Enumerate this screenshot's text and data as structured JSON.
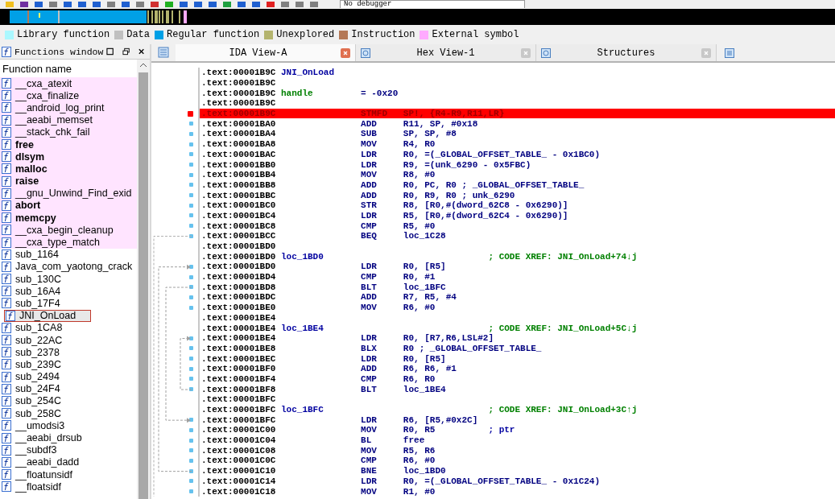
{
  "toolbar": {
    "debugger": "No debugger"
  },
  "legend": [
    {
      "label": "Library function",
      "color": "#aaf8ff"
    },
    {
      "label": "Data",
      "color": "#c0c0c0"
    },
    {
      "label": "Regular function",
      "color": "#00a0e6"
    },
    {
      "label": "Unexplored",
      "color": "#b4b46e"
    },
    {
      "label": "Instruction",
      "color": "#b47856"
    },
    {
      "label": "External symbol",
      "color": "#ffaaff"
    }
  ],
  "functions_window": {
    "title": "Functions window",
    "column": "Function name",
    "items": [
      {
        "name": "__cxa_atexit",
        "bold": false,
        "external": true,
        "selected": false
      },
      {
        "name": "__cxa_finalize",
        "bold": false,
        "external": true,
        "selected": false
      },
      {
        "name": "__android_log_print",
        "bold": false,
        "external": true,
        "selected": false
      },
      {
        "name": "__aeabi_memset",
        "bold": false,
        "external": true,
        "selected": false
      },
      {
        "name": "__stack_chk_fail",
        "bold": false,
        "external": true,
        "selected": false
      },
      {
        "name": "free",
        "bold": true,
        "external": true,
        "selected": false
      },
      {
        "name": "dlsym",
        "bold": true,
        "external": true,
        "selected": false
      },
      {
        "name": "malloc",
        "bold": true,
        "external": true,
        "selected": false
      },
      {
        "name": "raise",
        "bold": true,
        "external": true,
        "selected": false
      },
      {
        "name": "__gnu_Unwind_Find_exid",
        "bold": false,
        "external": true,
        "selected": false
      },
      {
        "name": "abort",
        "bold": true,
        "external": true,
        "selected": false
      },
      {
        "name": "memcpy",
        "bold": true,
        "external": true,
        "selected": false
      },
      {
        "name": "__cxa_begin_cleanup",
        "bold": false,
        "external": true,
        "selected": false
      },
      {
        "name": "__cxa_type_match",
        "bold": false,
        "external": true,
        "selected": false
      },
      {
        "name": "sub_1164",
        "bold": false,
        "external": false,
        "selected": false
      },
      {
        "name": "Java_com_yaotong_crack",
        "bold": false,
        "external": false,
        "selected": false
      },
      {
        "name": "sub_130C",
        "bold": false,
        "external": false,
        "selected": false
      },
      {
        "name": "sub_16A4",
        "bold": false,
        "external": false,
        "selected": false
      },
      {
        "name": "sub_17F4",
        "bold": false,
        "external": false,
        "selected": false
      },
      {
        "name": "JNI_OnLoad",
        "bold": false,
        "external": false,
        "selected": true
      },
      {
        "name": "sub_1CA8",
        "bold": false,
        "external": false,
        "selected": false
      },
      {
        "name": "sub_22AC",
        "bold": false,
        "external": false,
        "selected": false
      },
      {
        "name": "sub_2378",
        "bold": false,
        "external": false,
        "selected": false
      },
      {
        "name": "sub_239C",
        "bold": false,
        "external": false,
        "selected": false
      },
      {
        "name": "sub_2494",
        "bold": false,
        "external": false,
        "selected": false
      },
      {
        "name": "sub_24F4",
        "bold": false,
        "external": false,
        "selected": false
      },
      {
        "name": "sub_254C",
        "bold": false,
        "external": false,
        "selected": false
      },
      {
        "name": "sub_258C",
        "bold": false,
        "external": false,
        "selected": false
      },
      {
        "name": "__umodsi3",
        "bold": false,
        "external": false,
        "selected": false
      },
      {
        "name": "__aeabi_drsub",
        "bold": false,
        "external": false,
        "selected": false
      },
      {
        "name": "__subdf3",
        "bold": false,
        "external": false,
        "selected": false
      },
      {
        "name": "__aeabi_dadd",
        "bold": false,
        "external": false,
        "selected": false
      },
      {
        "name": "__floatunsidf",
        "bold": false,
        "external": false,
        "selected": false
      },
      {
        "name": "__floatsidf",
        "bold": false,
        "external": false,
        "selected": false
      }
    ]
  },
  "tabs": [
    {
      "label": "IDA View-A",
      "selected": true
    },
    {
      "label": "Hex View-1",
      "selected": false
    },
    {
      "label": "Structures",
      "selected": false
    }
  ],
  "lines": [
    {
      "kind": "label",
      "addr": ".text:00001B9C",
      "label": "JNI_OnLoad",
      "breakpoint": false
    },
    {
      "kind": "blank",
      "addr": ".text:00001B9C",
      "breakpoint": false
    },
    {
      "kind": "var",
      "addr": ".text:00001B9C",
      "label": "handle",
      "mnemonic": "= -0x20",
      "breakpoint": false
    },
    {
      "kind": "blank",
      "addr": ".text:00001B9C",
      "breakpoint": false
    },
    {
      "kind": "insn",
      "addr": ".text:00001B9C",
      "mnemonic": "STMFD",
      "operands": "SP!, {R4-R9,R11,LR}",
      "breakpoint": true
    },
    {
      "kind": "insn",
      "addr": ".text:00001BA0",
      "mnemonic": "ADD",
      "operands": "R11, SP, #0x18",
      "breakpoint": false
    },
    {
      "kind": "insn",
      "addr": ".text:00001BA4",
      "mnemonic": "SUB",
      "operands": "SP, SP, #8",
      "breakpoint": false
    },
    {
      "kind": "insn",
      "addr": ".text:00001BA8",
      "mnemonic": "MOV",
      "operands": "R4, R0",
      "breakpoint": false
    },
    {
      "kind": "insn",
      "addr": ".text:00001BAC",
      "mnemonic": "LDR",
      "operands": "R0, =(_GLOBAL_OFFSET_TABLE_ - 0x1BC0)",
      "breakpoint": false
    },
    {
      "kind": "insn",
      "addr": ".text:00001BB0",
      "mnemonic": "LDR",
      "operands": "R9, =(unk_6290 - 0x5FBC)",
      "breakpoint": false
    },
    {
      "kind": "insn",
      "addr": ".text:00001BB4",
      "mnemonic": "MOV",
      "operands": "R8, #0",
      "breakpoint": false
    },
    {
      "kind": "insn",
      "addr": ".text:00001BB8",
      "mnemonic": "ADD",
      "operands": "R0, PC, R0 ; _GLOBAL_OFFSET_TABLE_",
      "breakpoint": false
    },
    {
      "kind": "insn",
      "addr": ".text:00001BBC",
      "mnemonic": "ADD",
      "operands": "R0, R9, R0 ; unk_6290",
      "breakpoint": false
    },
    {
      "kind": "insn",
      "addr": ".text:00001BC0",
      "mnemonic": "STR",
      "operands": "R8, [R0,#(dword_62C8 - 0x6290)]",
      "breakpoint": false
    },
    {
      "kind": "insn",
      "addr": ".text:00001BC4",
      "mnemonic": "LDR",
      "operands": "R5, [R0,#(dword_62C4 - 0x6290)]",
      "breakpoint": false
    },
    {
      "kind": "insn",
      "addr": ".text:00001BC8",
      "mnemonic": "CMP",
      "operands": "R5, #0",
      "breakpoint": false
    },
    {
      "kind": "insn",
      "addr": ".text:00001BCC",
      "mnemonic": "BEQ",
      "operands": "loc_1C28",
      "breakpoint": false
    },
    {
      "kind": "blank",
      "addr": ".text:00001BD0",
      "breakpoint": false
    },
    {
      "kind": "label",
      "addr": ".text:00001BD0",
      "label": "loc_1BD0",
      "comment": "; CODE XREF: JNI_OnLoad+74↓j",
      "breakpoint": false
    },
    {
      "kind": "insn",
      "addr": ".text:00001BD0",
      "mnemonic": "LDR",
      "operands": "R0, [R5]",
      "breakpoint": false
    },
    {
      "kind": "insn",
      "addr": ".text:00001BD4",
      "mnemonic": "CMP",
      "operands": "R0, #1",
      "breakpoint": false
    },
    {
      "kind": "insn",
      "addr": ".text:00001BD8",
      "mnemonic": "BLT",
      "operands": "loc_1BFC",
      "breakpoint": false
    },
    {
      "kind": "insn",
      "addr": ".text:00001BDC",
      "mnemonic": "ADD",
      "operands": "R7, R5, #4",
      "breakpoint": false
    },
    {
      "kind": "insn",
      "addr": ".text:00001BE0",
      "mnemonic": "MOV",
      "operands": "R6, #0",
      "breakpoint": false
    },
    {
      "kind": "blank",
      "addr": ".text:00001BE4",
      "breakpoint": false
    },
    {
      "kind": "label",
      "addr": ".text:00001BE4",
      "label": "loc_1BE4",
      "comment": "; CODE XREF: JNI_OnLoad+5C↓j",
      "breakpoint": false
    },
    {
      "kind": "insn",
      "addr": ".text:00001BE4",
      "mnemonic": "LDR",
      "operands": "R0, [R7,R6,LSL#2]",
      "breakpoint": false
    },
    {
      "kind": "insn",
      "addr": ".text:00001BE8",
      "mnemonic": "BLX",
      "operands": "R0 ; _GLOBAL_OFFSET_TABLE_",
      "breakpoint": false
    },
    {
      "kind": "insn",
      "addr": ".text:00001BEC",
      "mnemonic": "LDR",
      "operands": "R0, [R5]",
      "breakpoint": false
    },
    {
      "kind": "insn",
      "addr": ".text:00001BF0",
      "mnemonic": "ADD",
      "operands": "R6, R6, #1",
      "breakpoint": false
    },
    {
      "kind": "insn",
      "addr": ".text:00001BF4",
      "mnemonic": "CMP",
      "operands": "R6, R0",
      "breakpoint": false
    },
    {
      "kind": "insn",
      "addr": ".text:00001BF8",
      "mnemonic": "BLT",
      "operands": "loc_1BE4",
      "breakpoint": false
    },
    {
      "kind": "blank",
      "addr": ".text:00001BFC",
      "breakpoint": false
    },
    {
      "kind": "label",
      "addr": ".text:00001BFC",
      "label": "loc_1BFC",
      "comment": "; CODE XREF: JNI_OnLoad+3C↑j",
      "breakpoint": false
    },
    {
      "kind": "insn",
      "addr": ".text:00001BFC",
      "mnemonic": "LDR",
      "operands": "R6, [R5,#0x2C]",
      "breakpoint": false
    },
    {
      "kind": "insn",
      "addr": ".text:00001C00",
      "mnemonic": "MOV",
      "operands": "R0, R5",
      "comment": "; ptr",
      "breakpoint": false
    },
    {
      "kind": "insn",
      "addr": ".text:00001C04",
      "mnemonic": "BL",
      "operands": "free",
      "breakpoint": false
    },
    {
      "kind": "insn",
      "addr": ".text:00001C08",
      "mnemonic": "MOV",
      "operands": "R5, R6",
      "breakpoint": false
    },
    {
      "kind": "insn",
      "addr": ".text:00001C0C",
      "mnemonic": "CMP",
      "operands": "R6, #0",
      "breakpoint": false
    },
    {
      "kind": "insn",
      "addr": ".text:00001C10",
      "mnemonic": "BNE",
      "operands": "loc_1BD0",
      "breakpoint": false
    },
    {
      "kind": "insn",
      "addr": ".text:00001C14",
      "mnemonic": "LDR",
      "operands": "R0, =(_GLOBAL_OFFSET_TABLE_ - 0x1C24)",
      "breakpoint": false
    },
    {
      "kind": "insn",
      "addr": ".text:00001C18",
      "mnemonic": "MOV",
      "operands": "R1, #0",
      "breakpoint": false
    }
  ]
}
